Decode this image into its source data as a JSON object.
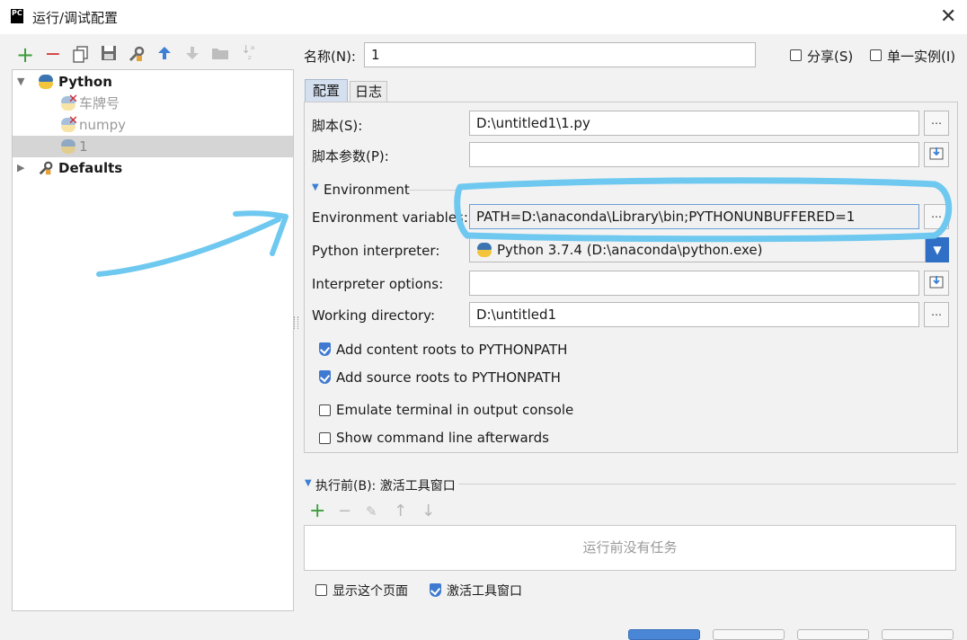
{
  "window": {
    "title": "运行/调试配置",
    "app_icon": "PC"
  },
  "toolbar": {
    "icons": [
      "add-icon",
      "remove-icon",
      "copy-icon",
      "save-icon",
      "wrench-icon",
      "move-up-icon",
      "move-down-icon",
      "folder-icon",
      "sort-icon"
    ]
  },
  "tree": {
    "python_label": "Python",
    "items": [
      {
        "label": "车牌号",
        "error": true
      },
      {
        "label": "numpy",
        "error": true
      },
      {
        "label": "1",
        "selected": true
      }
    ],
    "defaults_label": "Defaults"
  },
  "name": {
    "label": "名称(N):",
    "value": "1"
  },
  "share": {
    "label": "分享(S)",
    "checked": false
  },
  "single_instance": {
    "label": "单一实例(I)",
    "checked": false
  },
  "tabs": {
    "config": "配置",
    "log": "日志"
  },
  "script": {
    "label": "脚本(S):",
    "value": "D:\\untitled1\\1.py"
  },
  "script_params": {
    "label": "脚本参数(P):",
    "value": ""
  },
  "environment": {
    "section_label": "Environment"
  },
  "env_vars": {
    "label": "Environment variables:",
    "value": "PATH=D:\\anaconda\\Library\\bin;PYTHONUNBUFFERED=1"
  },
  "interpreter": {
    "label": "Python interpreter:",
    "value": "Python 3.7.4 (D:\\anaconda\\python.exe)"
  },
  "interp_options": {
    "label": "Interpreter options:",
    "value": ""
  },
  "working_dir": {
    "label": "Working directory:",
    "value": "D:\\untitled1"
  },
  "options": {
    "content_roots": {
      "label": "Add content roots to PYTHONPATH",
      "checked": true
    },
    "source_roots": {
      "label": "Add source roots to PYTHONPATH",
      "checked": true
    },
    "emulate_terminal": {
      "label": "Emulate terminal in output console",
      "checked": false
    },
    "show_cmd": {
      "label": "Show command line afterwards",
      "checked": false
    }
  },
  "before_launch": {
    "label": "执行前(B): 激活工具窗口",
    "empty_text": "运行前没有任务",
    "show_page": {
      "label": "显示这个页面",
      "checked": false
    },
    "activate_window": {
      "label": "激活工具窗口",
      "checked": true
    }
  },
  "colors": {
    "accent": "#3b74b0",
    "highlight_annotation": "#6ec8ef",
    "add_green": "#3a9d3a",
    "remove_red": "#d33a3a"
  }
}
